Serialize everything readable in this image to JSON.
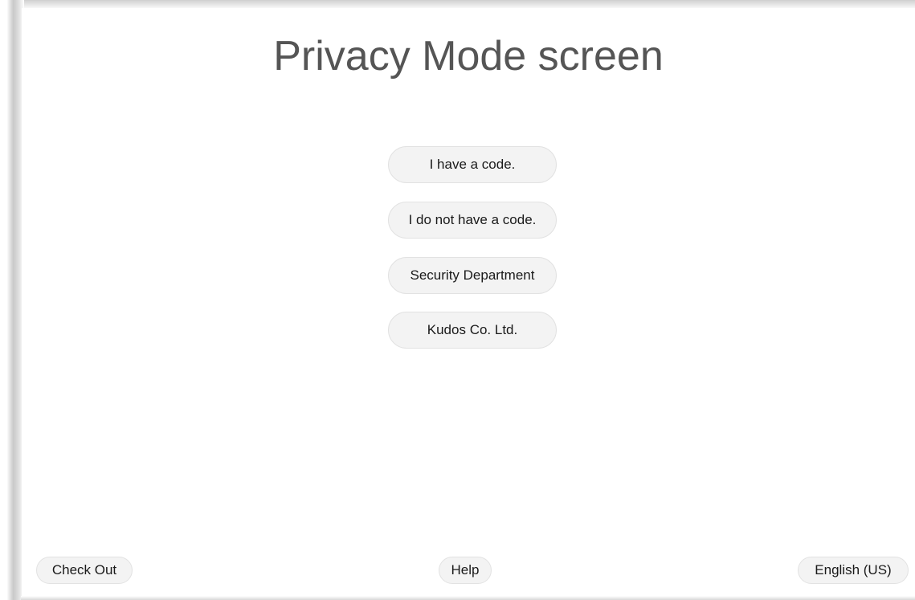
{
  "page": {
    "title": "Privacy Mode screen"
  },
  "options": [
    {
      "label": "I have a code."
    },
    {
      "label": "I do not have a code."
    },
    {
      "label": "Security Department"
    },
    {
      "label": "Kudos Co. Ltd."
    }
  ],
  "footer": {
    "check_out_label": "Check Out",
    "help_label": "Help",
    "language_label": "English (US)"
  },
  "colors": {
    "title_text": "#555555",
    "button_bg": "#f3f3f3",
    "button_border": "#e2e2e2",
    "button_text": "#1a1a1a",
    "background": "#ffffff"
  }
}
